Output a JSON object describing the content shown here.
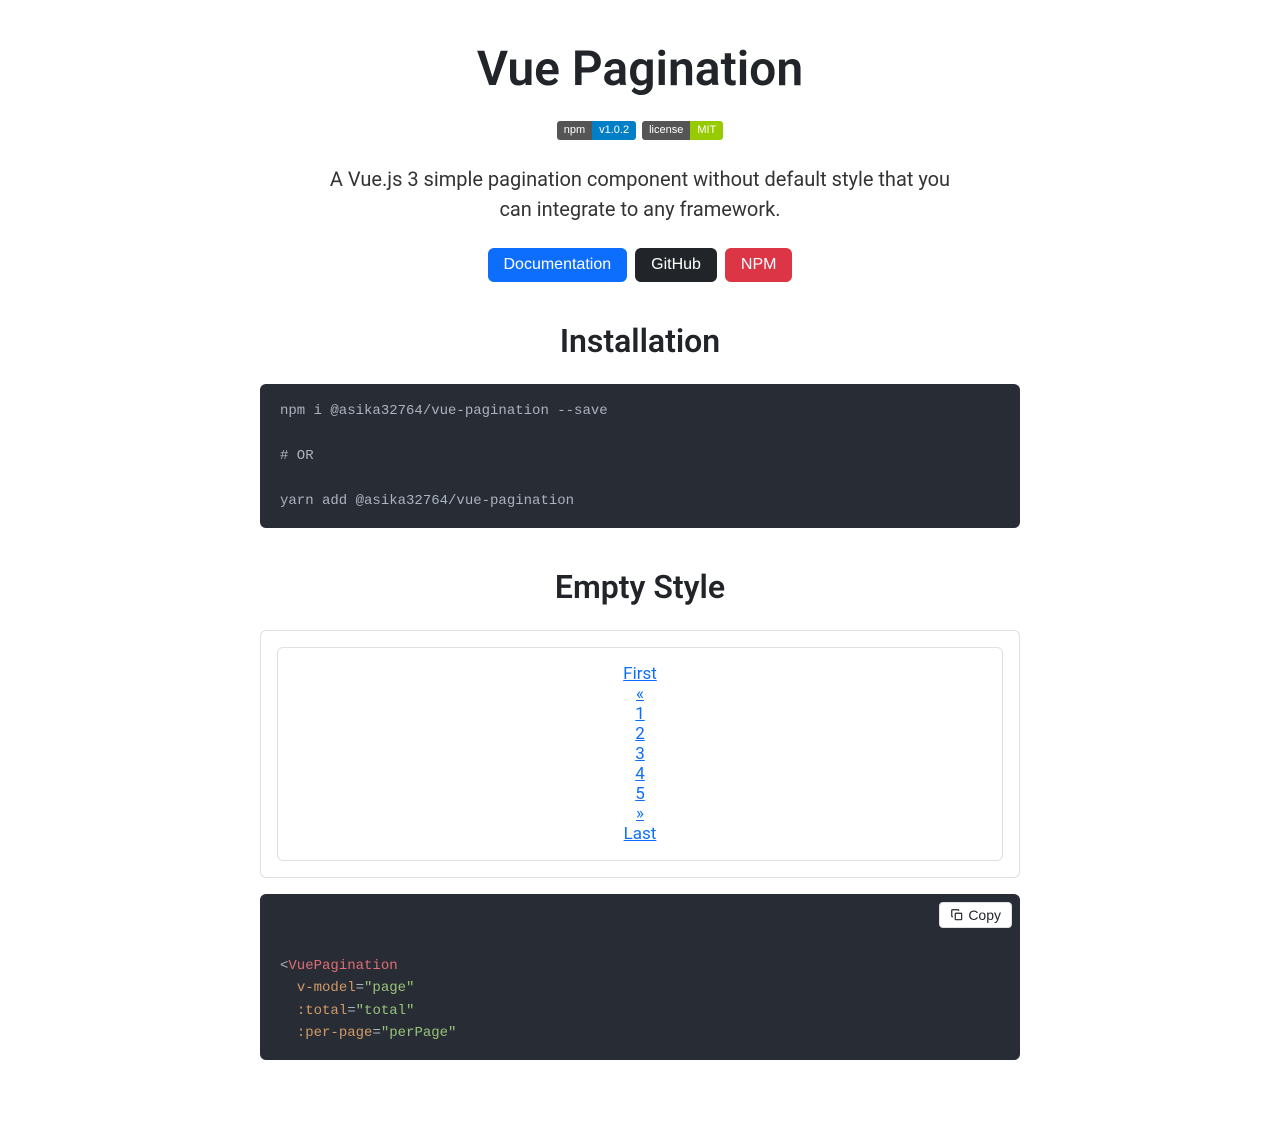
{
  "title": "Vue Pagination",
  "badges": {
    "npm": {
      "left": "npm",
      "right": "v1.0.2"
    },
    "license": {
      "left": "license",
      "right": "MIT"
    }
  },
  "lead": "A Vue.js 3 simple pagination component without default style that you can integrate to any framework.",
  "actions": {
    "docs": "Documentation",
    "github": "GitHub",
    "npm": "NPM"
  },
  "install": {
    "heading": "Installation",
    "code": "npm i @asika32764/vue-pagination --save\n\n# OR\n\nyarn add @asika32764/vue-pagination"
  },
  "empty": {
    "heading": "Empty Style",
    "pagination": [
      "First",
      "«",
      "1",
      "2",
      "3",
      "4",
      "5",
      "»",
      "Last"
    ],
    "copy_label": "Copy",
    "code": {
      "tag": "VuePagination",
      "attrs": [
        {
          "name": "v-model",
          "value": "\"page\""
        },
        {
          "name": ":total",
          "value": "\"total\""
        },
        {
          "name": ":per-page",
          "value": "\"perPage\""
        }
      ]
    }
  }
}
